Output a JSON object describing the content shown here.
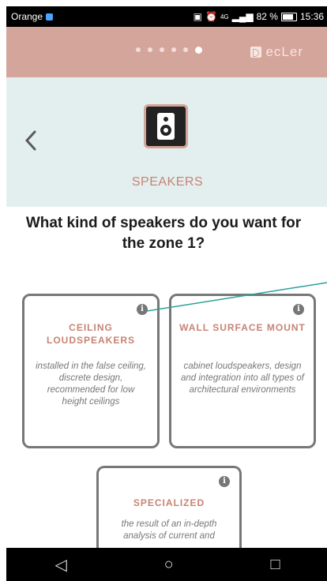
{
  "status_bar": {
    "carrier": "Orange",
    "battery_percent": "82 %",
    "time": "15:36",
    "signal_text": "4G"
  },
  "topbar": {
    "page_dots_total": 6,
    "page_dots_active": 6,
    "brand": "ecLer",
    "background_color": "#d4a59a"
  },
  "header": {
    "title": "SPEAKERS",
    "icon": "speaker-icon",
    "back_icon": "chevron-left-icon"
  },
  "question": "What kind of speakers do you want for the zone 1?",
  "options": [
    {
      "title": "CEILING LOUDSPEAKERS",
      "description": "installed in the false ceiling, discrete design, recommended for low height ceilings",
      "info_icon": "info-icon"
    },
    {
      "title": "WALL SURFACE MOUNT",
      "description": "cabinet loudspeakers, design and integration into all types of architectural environments",
      "info_icon": "info-icon"
    },
    {
      "title": "SPECIALIZED",
      "description": "the result of an in-depth analysis of current and",
      "info_icon": "info-icon"
    }
  ],
  "nav_bar": {
    "back": "◁",
    "home": "○",
    "recents": "□"
  },
  "colors": {
    "accent": "#c78374",
    "header_bg": "#e3efef",
    "card_border": "#777777",
    "annotation": "#2aa198"
  }
}
